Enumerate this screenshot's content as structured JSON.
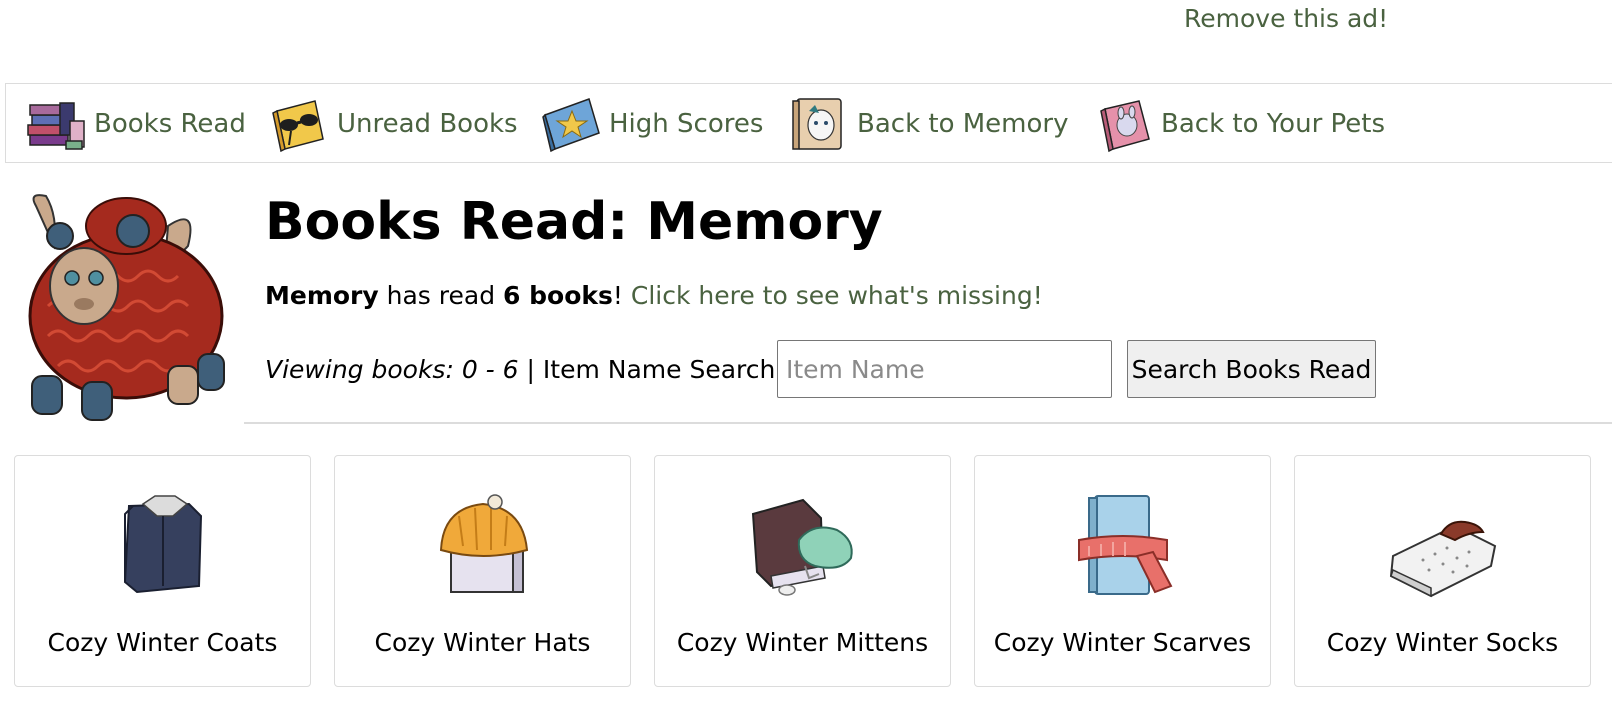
{
  "ad": {
    "remove_label": "Remove this ad!"
  },
  "nav": {
    "items": [
      {
        "label": "Books Read",
        "icon": "book-stack-icon"
      },
      {
        "label": "Unread Books",
        "icon": "book-sunglasses-icon"
      },
      {
        "label": "High Scores",
        "icon": "star-book-icon"
      },
      {
        "label": "Back to Memory",
        "icon": "pet-portrait-book-icon"
      },
      {
        "label": "Back to Your Pets",
        "icon": "pets-book-icon"
      }
    ]
  },
  "page": {
    "title": "Books Read: Memory",
    "pet_name": "Memory",
    "has_read_text": "has read",
    "book_count": "6 books",
    "exclaim": "!",
    "missing_link": "Click here to see what's missing!",
    "viewing": "Viewing books: 0 - 6",
    "separator": "|",
    "search_label": "Item Name Search:",
    "search_placeholder": "Item Name",
    "search_button": "Search Books Read"
  },
  "books": [
    {
      "name": "Cozy Winter Coats",
      "icon": "coat-book-icon"
    },
    {
      "name": "Cozy Winter Hats",
      "icon": "hat-book-icon"
    },
    {
      "name": "Cozy Winter Mittens",
      "icon": "mitten-book-icon"
    },
    {
      "name": "Cozy Winter Scarves",
      "icon": "scarf-book-icon"
    },
    {
      "name": "Cozy Winter Socks",
      "icon": "sock-book-icon"
    }
  ]
}
